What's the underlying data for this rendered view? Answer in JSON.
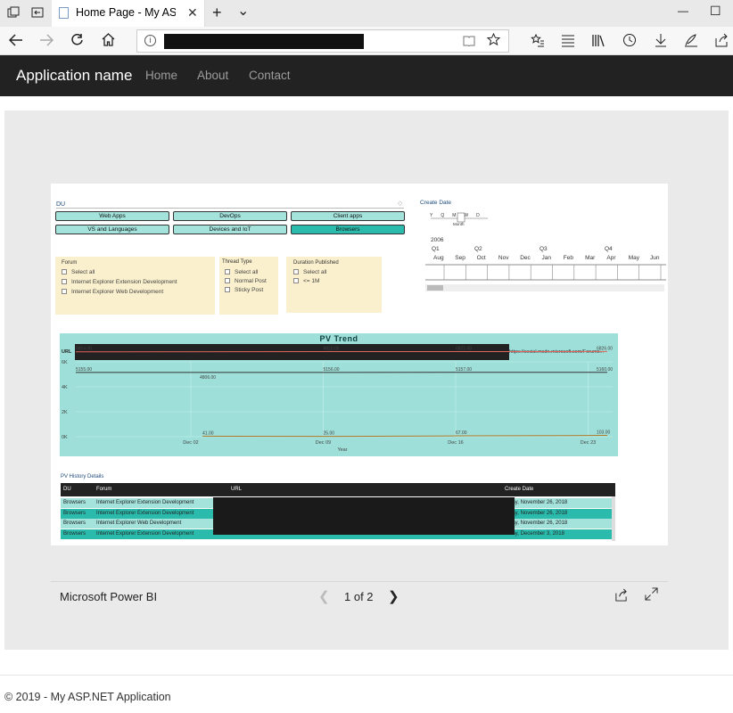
{
  "browser": {
    "tab_title": "Home Page - My ASP.N",
    "tab_close": "✕",
    "new_tab": "+",
    "tab_list": "⌄",
    "minimize": "—",
    "maximize": "☐"
  },
  "navbar": {
    "brand": "Application name",
    "links": [
      "Home",
      "About",
      "Contact"
    ]
  },
  "report": {
    "du_title": "DU",
    "du_buttons": [
      {
        "label": "Web Apps",
        "selected": false
      },
      {
        "label": "DevOps",
        "selected": false
      },
      {
        "label": "Client apps",
        "selected": false
      },
      {
        "label": "VS and Languages",
        "selected": false
      },
      {
        "label": "Devices and IoT",
        "selected": false
      },
      {
        "label": "Browsers",
        "selected": true
      }
    ],
    "forum": {
      "title": "Forum",
      "items": [
        "Select all",
        "Internet Explorer Extension Development",
        "Internet Explorer Web Development"
      ]
    },
    "thread_type": {
      "title": "Thread Type",
      "items": [
        "Select all",
        "Normal Post",
        "Sticky Post"
      ]
    },
    "duration": {
      "title": "Duration Published",
      "items": [
        "Select all",
        "<= 1M"
      ]
    },
    "create_date": {
      "title": "Create Date",
      "granularity": [
        "Y",
        "Q",
        "M",
        "W",
        "D"
      ],
      "granularity_selected": "Month",
      "year": "2006",
      "quarters": [
        "Q1",
        "Q2",
        "Q3",
        "Q4"
      ],
      "months": [
        "Aug",
        "Sep",
        "Oct",
        "Nov",
        "Dec",
        "Jan",
        "Feb",
        "Mar",
        "Apr",
        "May",
        "Jun"
      ]
    },
    "table": {
      "title": "PV History Details",
      "headers": [
        "DU",
        "Forum",
        "URL",
        "Create Date"
      ],
      "rows": [
        {
          "du": "Browsers",
          "forum": "Internet Explorer Extension Development",
          "url": "",
          "date": "...day, November 26, 2018"
        },
        {
          "du": "Browsers",
          "forum": "Internet Explorer Extension Development",
          "url": "",
          "date": "...day, November 26, 2018"
        },
        {
          "du": "Browsers",
          "forum": "Internet Explorer Web Development",
          "url": "",
          "date": "...day, November 26, 2018"
        },
        {
          "du": "Browsers",
          "forum": "Internet Explorer Extension Development",
          "url": "",
          "date": "...day, December 3, 2018"
        }
      ]
    }
  },
  "chart_data": {
    "type": "line",
    "title": "PV Trend",
    "legend_label": "URL",
    "legend_link": "https://social.msdn.microsoft.com/Forums...",
    "xlabel": "Year",
    "ylabel": "",
    "x": [
      "Dec 02",
      "Dec 09",
      "Dec 16",
      "Dec 23"
    ],
    "yticks": [
      "0K",
      "2K",
      "4K",
      "6K"
    ],
    "ylim": [
      0,
      6000
    ],
    "series": [
      {
        "values": [
          6804,
          6820,
          6822,
          6826
        ],
        "color": "#e0655a",
        "labels": [
          "6804.00",
          "6820.00",
          "6822.00",
          "6826.00"
        ]
      },
      {
        "values": [
          5155,
          5156,
          5157,
          5160
        ],
        "color": "#333333",
        "labels": [
          "5155.00",
          "5156.00",
          "5157.00",
          "5160.00"
        ]
      },
      {
        "values": [
          41,
          25,
          67,
          103
        ],
        "color": "#b07a2a",
        "labels": [
          "41.00",
          "25.00",
          "67.00",
          "103.00"
        ]
      }
    ],
    "extra_label": "4806.00",
    "grid": true
  },
  "powerbi": {
    "label": "Microsoft Power BI",
    "page": "1 of 2"
  },
  "footer": "© 2019 - My ASP.NET Application"
}
